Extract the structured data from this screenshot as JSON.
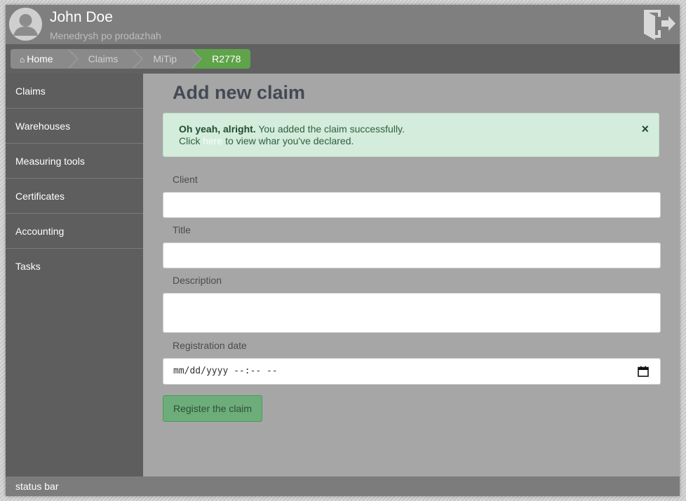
{
  "header": {
    "user_name": "John Doe",
    "user_role": "Menedrysh po prodazhah"
  },
  "breadcrumb": {
    "items": [
      {
        "label": "Home",
        "icon": "home-icon"
      },
      {
        "label": "Claims"
      },
      {
        "label": "MiTip"
      },
      {
        "label": "R2778",
        "active": true
      }
    ]
  },
  "sidebar": {
    "items": [
      {
        "label": "Claims"
      },
      {
        "label": "Warehouses"
      },
      {
        "label": "Measuring tools"
      },
      {
        "label": "Certificates"
      },
      {
        "label": "Accounting"
      },
      {
        "label": "Tasks"
      }
    ]
  },
  "main": {
    "title": "Add new claim",
    "alert": {
      "strong": "Oh yeah, alright.",
      "message": " You added the claim successfully.",
      "line2_prefix": "Click ",
      "link": "here",
      "line2_suffix": " to view whar you've declared.",
      "close_icon": "×"
    },
    "form": {
      "client_label": "Client",
      "client_value": "",
      "title_label": "Title",
      "title_value": "",
      "description_label": "Description",
      "description_value": "",
      "date_label": "Registration date",
      "date_placeholder": "mm/dd/yyyy --:-- --",
      "submit_label": "Register the claim"
    }
  },
  "statusbar": {
    "text": "status bar"
  },
  "colors": {
    "header_bg": "#7f7f7f",
    "sidebar_bg": "#5e5e5e",
    "main_bg": "#a6a6a6",
    "accent_green": "#5fa34a",
    "alert_bg": "#d4ecdc",
    "title_color": "#434a54"
  }
}
